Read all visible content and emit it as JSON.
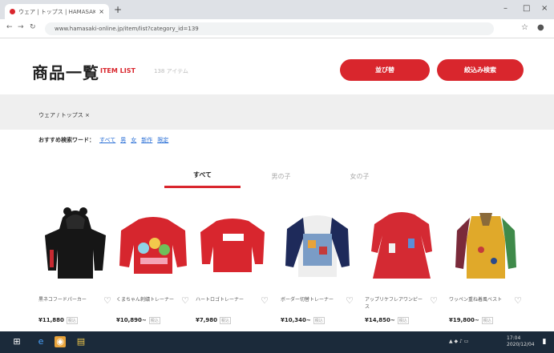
{
  "browser": {
    "tab_title": "ウェア | トップス | HAMASAKI Online Store",
    "close": "×",
    "new_tab": "+",
    "url": "www.hamasaki-online.jp/item/list?category_id=139",
    "minimize": "–",
    "maximize": "□",
    "window_close": "×"
  },
  "header": {
    "title": "商品一覧",
    "subtitle": "ITEM LIST",
    "count": "138 アイテム",
    "btn_sort": "並び替",
    "btn_filter": "絞込み検索"
  },
  "breadcrumb": "ウェア / トップス ×",
  "keywords": {
    "label": "おすすめ検索ワード：",
    "items": [
      "すべて",
      "男",
      "女",
      "新作",
      "限定"
    ]
  },
  "tabs": [
    "すべて",
    "男の子",
    "女の子"
  ],
  "products": [
    {
      "name": "黒ネコフードパーカー",
      "price": "¥11,880",
      "tax": "税込"
    },
    {
      "name": "くまちゃん刺繍トレーナー",
      "price": "¥10,890~",
      "tax": "税込"
    },
    {
      "name": "ハートロゴトレーナー",
      "price": "¥7,980",
      "tax": "税込"
    },
    {
      "name": "ボーダー切替トレーナー",
      "price": "¥10,340~",
      "tax": "税込"
    },
    {
      "name": "アップリケフレアワンピース",
      "price": "¥14,850~",
      "tax": "税込"
    },
    {
      "name": "ワッペン重ね着風ベスト",
      "price": "¥19,800~",
      "tax": "税込"
    }
  ],
  "taskbar": {
    "time": "17:04",
    "date": "2020/12/04"
  },
  "colors": {
    "accent": "#d9262d",
    "link": "#2a6fd6",
    "taskbar": "#1b2a3a"
  }
}
